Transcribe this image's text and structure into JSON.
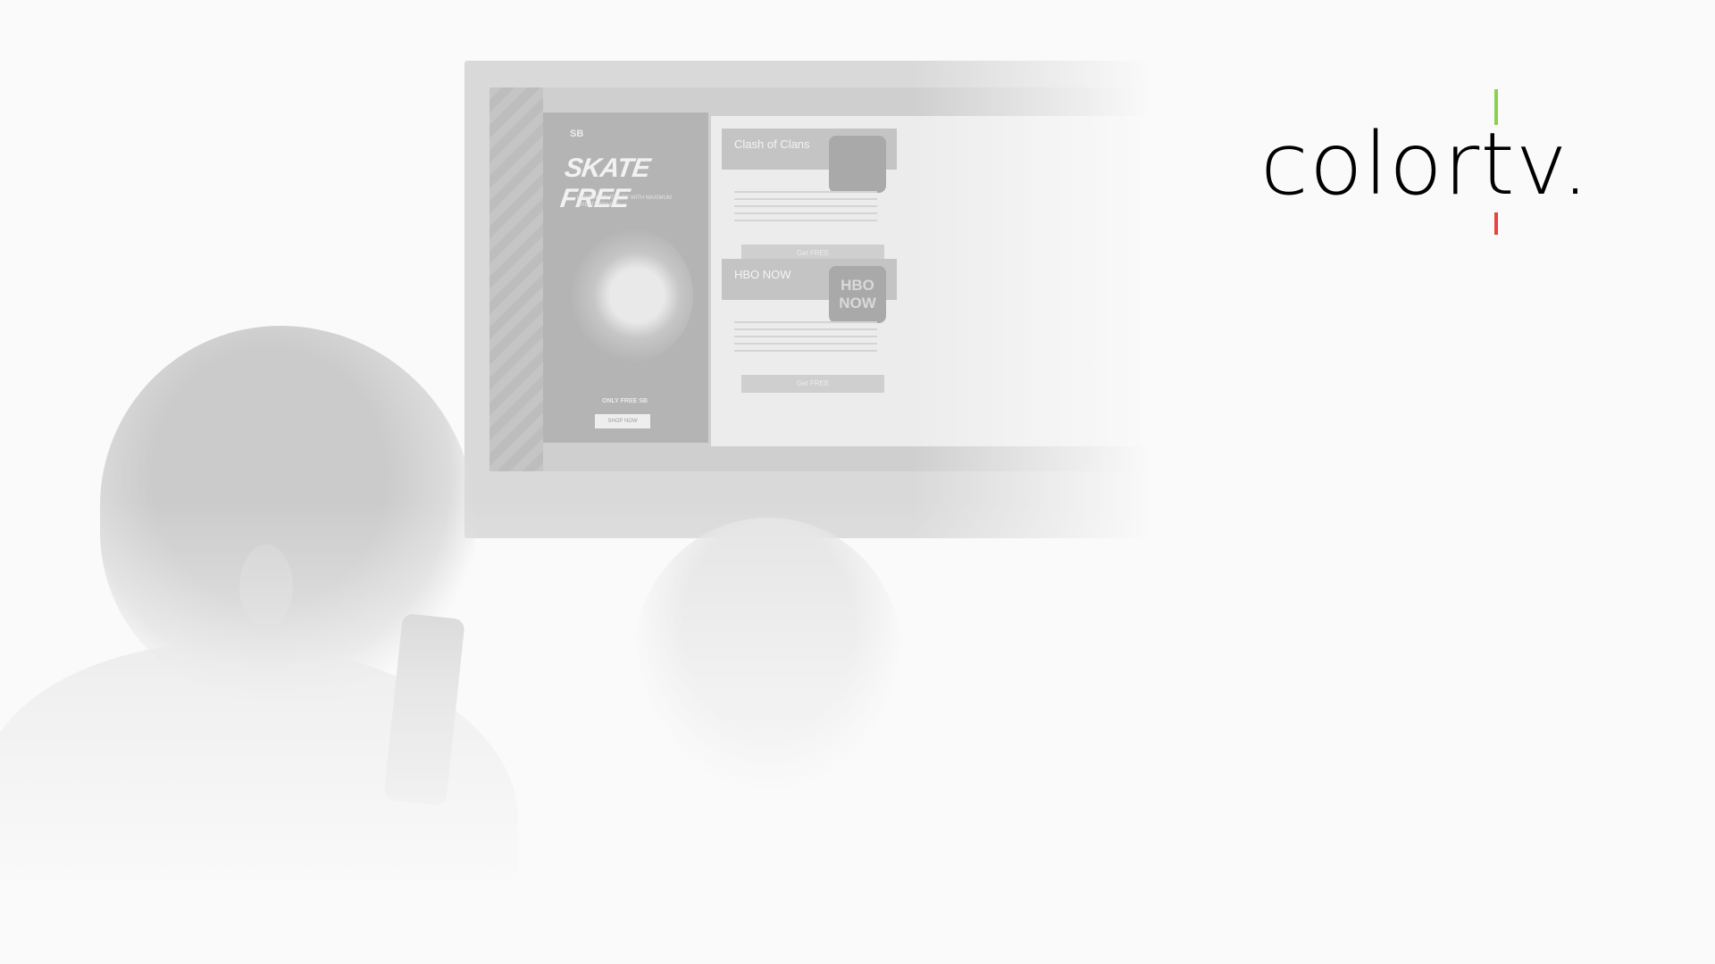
{
  "brand": {
    "logo_text": "colortv.",
    "frame_colors": [
      "#8bd14f",
      "#b48be6",
      "#4fb3e6",
      "#f2a640",
      "#e8443b"
    ]
  },
  "background": {
    "ad": {
      "title": "SKATE FREE",
      "subtitle": "LIGHTWEIGHT FLEX WITH MAXIMUM BREATHABILITY",
      "offer": "ONLY FREE SB",
      "cta": "SHOP NOW"
    },
    "cards": [
      {
        "name": "Clash of Clans",
        "thumb": "",
        "button": "Get FREE"
      },
      {
        "name": "HBO NOW",
        "thumb": "HBO NOW",
        "button": "Get FREE"
      }
    ]
  }
}
